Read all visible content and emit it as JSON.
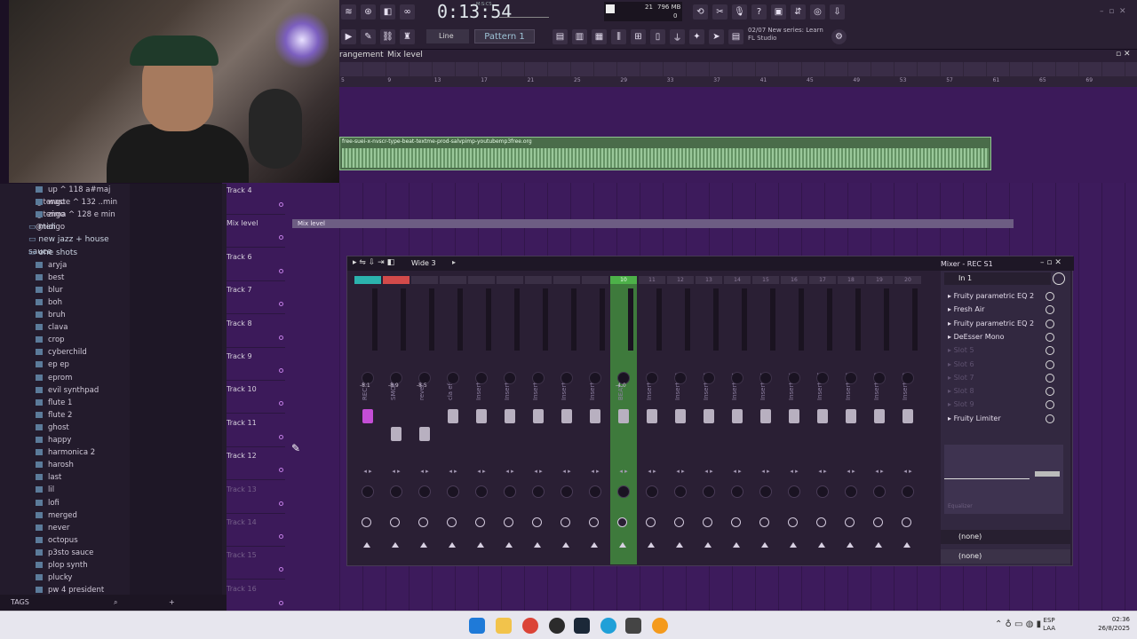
{
  "toolbar": {
    "time": "0:13:54",
    "time_sub": "M:S:CS",
    "line_label": "Line",
    "pattern_label": "Pattern 1",
    "cpu_value": "21",
    "mem_value": "796 MB",
    "zero": "0",
    "hint_date": "02/07",
    "hint_line1": "New series: Learn",
    "hint_line2": "FL Studio"
  },
  "playlist": {
    "breadcrumb_a": "rangement",
    "breadcrumb_b": "Mix level",
    "clip_name": "free-suei-x-nvscr-type-beat-textme-prod-salvpimp-youtubemp3free.org",
    "automation_name": "Mix level",
    "ruler": [
      "25",
      "29",
      "33",
      "37",
      "41",
      "45",
      "49",
      "53",
      "57",
      "61",
      "65",
      "69"
    ],
    "ruler_top": [
      "5",
      "9",
      "13",
      "17",
      "21",
      "25",
      "29",
      "33",
      "37",
      "41",
      "45",
      "49",
      "53",
      "57",
      "61",
      "65",
      "69"
    ],
    "tracks": [
      {
        "label": "Track 4",
        "dim": false
      },
      {
        "label": "Mix level",
        "dim": false
      },
      {
        "label": "Track 6",
        "dim": false
      },
      {
        "label": "Track 7",
        "dim": false
      },
      {
        "label": "Track 8",
        "dim": false
      },
      {
        "label": "Track 9",
        "dim": false
      },
      {
        "label": "Track 10",
        "dim": false
      },
      {
        "label": "Track 11",
        "dim": false
      },
      {
        "label": "Track 12",
        "dim": false
      },
      {
        "label": "Track 13",
        "dim": true
      },
      {
        "label": "Track 14",
        "dim": true
      },
      {
        "label": "Track 15",
        "dim": true
      },
      {
        "label": "Track 16",
        "dim": true
      }
    ]
  },
  "browser": {
    "items": [
      {
        "label": "up ^ 118 a#maj @tengo",
        "type": "file"
      },
      {
        "label": "waste ^ 132 ..min @tengo",
        "type": "file"
      },
      {
        "label": "zima ^ 128 e min @tengo",
        "type": "file"
      },
      {
        "label": "midi",
        "type": "folder"
      },
      {
        "label": "new jazz + house sauce",
        "type": "folder"
      },
      {
        "label": "one shots",
        "type": "folder-open"
      },
      {
        "label": "aryja",
        "type": "file"
      },
      {
        "label": "best",
        "type": "file"
      },
      {
        "label": "blur",
        "type": "file"
      },
      {
        "label": "boh",
        "type": "file"
      },
      {
        "label": "bruh",
        "type": "file"
      },
      {
        "label": "clava",
        "type": "file"
      },
      {
        "label": "crop",
        "type": "file"
      },
      {
        "label": "cyberchild",
        "type": "file"
      },
      {
        "label": "ep ep",
        "type": "file"
      },
      {
        "label": "eprom",
        "type": "file"
      },
      {
        "label": "evil synthpad",
        "type": "file"
      },
      {
        "label": "flute 1",
        "type": "file"
      },
      {
        "label": "flute 2",
        "type": "file"
      },
      {
        "label": "ghost",
        "type": "file"
      },
      {
        "label": "happy",
        "type": "file"
      },
      {
        "label": "harmonica 2",
        "type": "file"
      },
      {
        "label": "harosh",
        "type": "file"
      },
      {
        "label": "last",
        "type": "file"
      },
      {
        "label": "lil",
        "type": "file"
      },
      {
        "label": "lofi",
        "type": "file"
      },
      {
        "label": "merged",
        "type": "file"
      },
      {
        "label": "never",
        "type": "file"
      },
      {
        "label": "octopus",
        "type": "file"
      },
      {
        "label": "p3sto sauce",
        "type": "file"
      },
      {
        "label": "plop synth",
        "type": "file"
      },
      {
        "label": "plucky",
        "type": "file"
      },
      {
        "label": "pw 4 president",
        "type": "file"
      }
    ],
    "tags_label": "TAGS"
  },
  "mixer": {
    "preset": "Wide 3",
    "title": "Mixer - REC S1",
    "input": "In 1",
    "strips": [
      {
        "num": "",
        "name": "REC S1",
        "vol": "-8.1",
        "kind": "first"
      },
      {
        "num": "",
        "name": "SMOKE",
        "vol": "-8.9",
        "kind": "sel"
      },
      {
        "num": "",
        "name": "reverb",
        "vol": "-8.5",
        "kind": ""
      },
      {
        "num": "",
        "name": "cla efx",
        "vol": "",
        "kind": ""
      },
      {
        "num": "",
        "name": "Insert 5",
        "vol": "",
        "kind": ""
      },
      {
        "num": "",
        "name": "Insert 6",
        "vol": "",
        "kind": ""
      },
      {
        "num": "",
        "name": "Insert 7",
        "vol": "",
        "kind": ""
      },
      {
        "num": "",
        "name": "Insert 8",
        "vol": "",
        "kind": ""
      },
      {
        "num": "",
        "name": "Insert 9",
        "vol": "",
        "kind": ""
      },
      {
        "num": "10",
        "name": "BEAT",
        "vol": "-4.0",
        "kind": "green"
      },
      {
        "num": "11",
        "name": "Insert 11",
        "vol": "",
        "kind": ""
      },
      {
        "num": "12",
        "name": "Insert 12",
        "vol": "",
        "kind": ""
      },
      {
        "num": "13",
        "name": "Insert 13",
        "vol": "",
        "kind": ""
      },
      {
        "num": "14",
        "name": "Insert 14",
        "vol": "",
        "kind": ""
      },
      {
        "num": "15",
        "name": "Insert 15",
        "vol": "",
        "kind": ""
      },
      {
        "num": "16",
        "name": "Insert 16",
        "vol": "",
        "kind": ""
      },
      {
        "num": "17",
        "name": "Insert 17",
        "vol": "",
        "kind": ""
      },
      {
        "num": "18",
        "name": "Insert 18",
        "vol": "",
        "kind": ""
      },
      {
        "num": "19",
        "name": "Insert 19",
        "vol": "",
        "kind": ""
      },
      {
        "num": "20",
        "name": "Insert 20",
        "vol": "",
        "kind": ""
      }
    ],
    "slots": [
      {
        "label": "Fruity parametric EQ 2",
        "on": true
      },
      {
        "label": "Fresh Air",
        "on": true
      },
      {
        "label": "Fruity parametric EQ 2",
        "on": true
      },
      {
        "label": "DeEsser Mono",
        "on": true
      },
      {
        "label": "Slot 5",
        "on": false
      },
      {
        "label": "Slot 6",
        "on": false
      },
      {
        "label": "Slot 7",
        "on": false
      },
      {
        "label": "Slot 8",
        "on": false
      },
      {
        "label": "Slot 9",
        "on": false
      },
      {
        "label": "Fruity Limiter",
        "on": true
      }
    ],
    "eq_label": "Equalizer",
    "out1": "(none)",
    "out2": "(none)"
  },
  "taskbar": {
    "lang_top": "ESP",
    "lang_bottom": "LAA",
    "time": "02:36",
    "date": "26/8/2025"
  }
}
